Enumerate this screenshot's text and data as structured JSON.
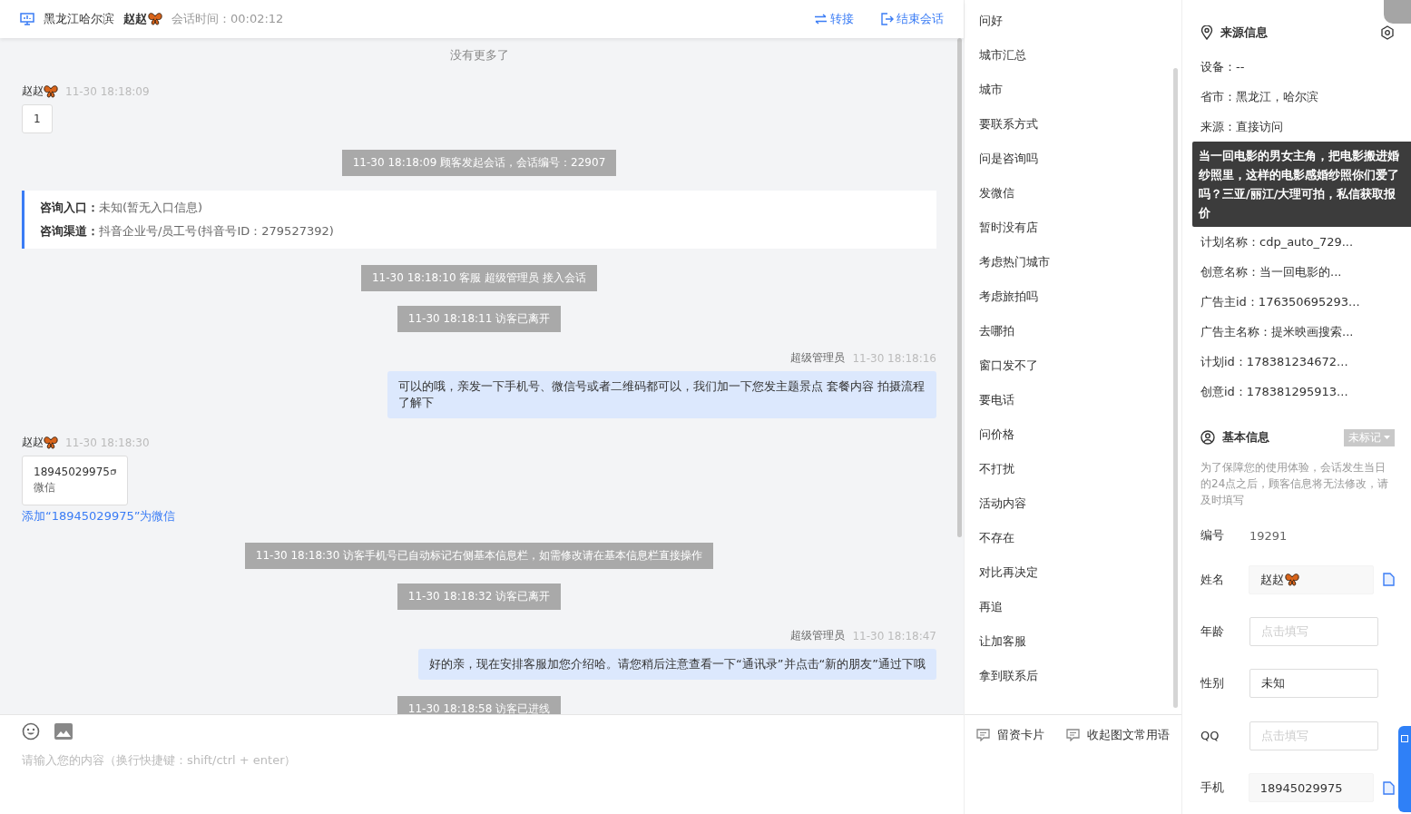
{
  "header": {
    "location": "黑龙江哈尔滨",
    "visitor": "赵赵",
    "session_label": "会话时间：",
    "session_time": "00:02:12",
    "actions": [
      {
        "kind": "transfer",
        "label": "转接"
      },
      {
        "kind": "end",
        "label": "结束会话"
      }
    ]
  },
  "messages": [
    {
      "kind": "end",
      "text": "没有更多了"
    },
    {
      "kind": "visitor",
      "name": "赵赵",
      "time": "11-30 18:18:09",
      "text": "1"
    },
    {
      "kind": "system",
      "text": "11-30 18:18:09 顾客发起会话，会话编号：22907"
    },
    {
      "kind": "entry",
      "lines": [
        {
          "label": "咨询入口：",
          "value": "未知(暂无入口信息)"
        },
        {
          "label": "咨询渠道：",
          "value": "抖音企业号/员工号(抖音号ID：279527392)"
        }
      ]
    },
    {
      "kind": "system",
      "text": "11-30 18:18:10 客服 超级管理员 接入会话"
    },
    {
      "kind": "system",
      "text": "11-30 18:18:11 访客已离开"
    },
    {
      "kind": "agent",
      "name": "超级管理员",
      "time": "11-30 18:18:16",
      "text": "可以的哦，亲发一下手机号、微信号或者二维码都可以，我们加一下您发主题景点 套餐内容 拍摄流程了解下"
    },
    {
      "kind": "card",
      "name": "赵赵",
      "time": "11-30 18:18:30",
      "phone": "18945029975",
      "type": "微信",
      "link": "添加“18945029975”为微信"
    },
    {
      "kind": "system",
      "text": "11-30 18:18:30 访客手机号已自动标记右侧基本信息栏，如需修改请在基本信息栏直接操作"
    },
    {
      "kind": "system",
      "text": "11-30 18:18:32 访客已离开"
    },
    {
      "kind": "agent",
      "name": "超级管理员",
      "time": "11-30 18:18:47",
      "text": "好的亲，现在安排客服加您介绍哈。请您稍后注意查看一下“通讯录”并点击“新的朋友”通过下哦"
    },
    {
      "kind": "system",
      "text": "11-30 18:18:58 访客已进线"
    }
  ],
  "composer": {
    "placeholder": "请输入您的内容（换行快捷键：shift/ctrl + enter）"
  },
  "quick_phrases": [
    "问好",
    "城市汇总",
    "城市",
    "要联系方式",
    "问是咨询吗",
    "发微信",
    "暂时没有店",
    "考虑热门城市",
    "考虑旅拍吗",
    "去哪拍",
    "窗口发不了",
    "要电话",
    "问价格",
    "不打扰",
    "活动内容",
    "不存在",
    "对比再决定",
    "再追",
    "让加客服",
    "拿到联系后"
  ],
  "quick_actions": [
    {
      "label": "留资卡片"
    },
    {
      "label": "收起图文常用语"
    }
  ],
  "source_info": {
    "title": "来源信息",
    "rows_before": [
      "设备：--",
      "省市：黑龙江，哈尔滨",
      "来源：直接访问"
    ],
    "tooltip": "当一回电影的男女主角，把电影搬进婚纱照里，这样的电影感婚纱照你们爱了吗？三亚/丽江/大理可拍，私信获取报价",
    "rows_after": [
      "计划名称：cdp_auto_729...",
      "创意名称：当一回电影的...",
      "广告主id：176350695293...",
      "广告主名称：提米映画搜索...",
      "计划id：178381234672...",
      "创意id：178381295913..."
    ]
  },
  "basic_info": {
    "title": "基本信息",
    "tag": "未标记",
    "notice": "为了保障您的使用体验，会话发生当日的24点之后，顾客信息将无法修改，请及时填写",
    "fields": [
      {
        "kind": "text",
        "label": "编号",
        "value": "19291"
      },
      {
        "kind": "readonly",
        "label": "姓名",
        "value": "赵赵",
        "butterfly": true,
        "copy": true
      },
      {
        "kind": "input",
        "label": "年龄",
        "placeholder": "点击填写"
      },
      {
        "kind": "input",
        "label": "性别",
        "value": "未知"
      },
      {
        "kind": "input",
        "label": "QQ",
        "placeholder": "点击填写"
      },
      {
        "kind": "readonly",
        "label": "手机",
        "value": "18945029975",
        "copy": true
      }
    ]
  }
}
